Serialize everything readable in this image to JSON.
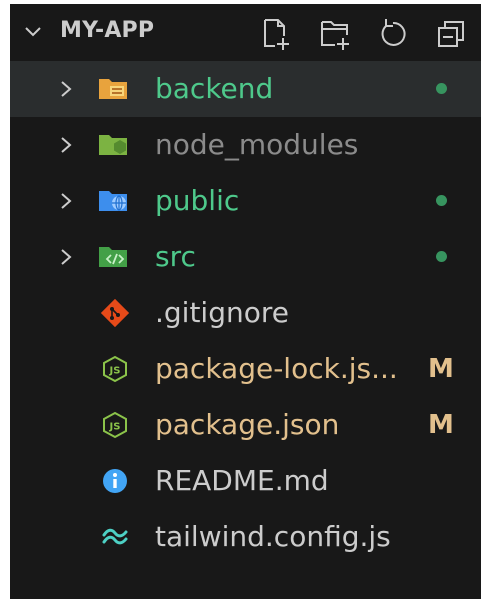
{
  "explorer": {
    "title": "MY-APP",
    "actions": [
      {
        "name": "new-file-icon"
      },
      {
        "name": "new-folder-icon"
      },
      {
        "name": "refresh-icon"
      },
      {
        "name": "collapse-all-icon"
      }
    ]
  },
  "colors": {
    "green_text": "#4ec98b",
    "dim_text": "#8b8b8b",
    "normal_text": "#cccccc",
    "modified_text": "#e2c08d",
    "green_dot": "#37945f",
    "badge": "#e2c08d"
  },
  "items": [
    {
      "label": "backend",
      "type": "folder",
      "icon": "folder-backend-icon",
      "status": "dot"
    },
    {
      "label": "node_modules",
      "type": "folder",
      "icon": "folder-node-icon",
      "status": ""
    },
    {
      "label": "public",
      "type": "folder",
      "icon": "folder-public-icon",
      "status": "dot"
    },
    {
      "label": "src",
      "type": "folder",
      "icon": "folder-src-icon",
      "status": "dot"
    },
    {
      "label": ".gitignore",
      "type": "file",
      "icon": "git-icon",
      "status": ""
    },
    {
      "label": "package-lock.js...",
      "type": "file",
      "icon": "nodejs-icon",
      "status": "M"
    },
    {
      "label": "package.json",
      "type": "file",
      "icon": "nodejs-icon",
      "status": "M"
    },
    {
      "label": "README.md",
      "type": "file",
      "icon": "info-icon",
      "status": ""
    },
    {
      "label": "tailwind.config.js",
      "type": "file",
      "icon": "tailwind-icon",
      "status": ""
    }
  ]
}
